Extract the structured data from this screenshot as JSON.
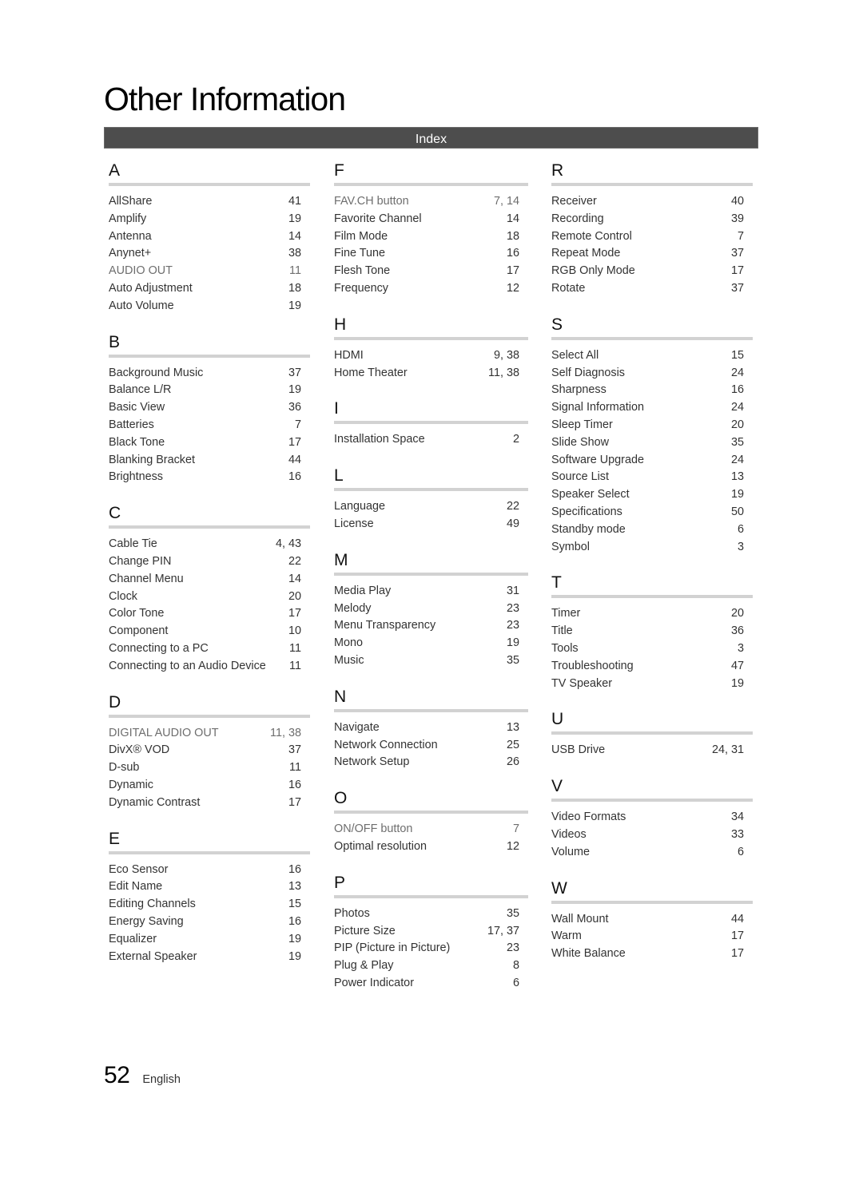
{
  "page": {
    "title": "Other Information",
    "section_bar": "Index",
    "page_number": "52",
    "language": "English"
  },
  "columns": [
    {
      "sections": [
        {
          "letter": "A",
          "entries": [
            {
              "term": "AllShare",
              "pages": "41"
            },
            {
              "term": "Amplify",
              "pages": "19"
            },
            {
              "term": "Antenna",
              "pages": "14"
            },
            {
              "term": "Anynet+",
              "pages": "38"
            },
            {
              "term": "AUDIO OUT",
              "pages": "11",
              "light": true
            },
            {
              "term": "Auto Adjustment",
              "pages": "18"
            },
            {
              "term": "Auto Volume",
              "pages": "19"
            }
          ]
        },
        {
          "letter": "B",
          "entries": [
            {
              "term": "Background Music",
              "pages": "37"
            },
            {
              "term": "Balance L/R",
              "pages": "19"
            },
            {
              "term": "Basic View",
              "pages": "36"
            },
            {
              "term": "Batteries",
              "pages": "7"
            },
            {
              "term": "Black Tone",
              "pages": "17"
            },
            {
              "term": "Blanking Bracket",
              "pages": "44"
            },
            {
              "term": "Brightness",
              "pages": "16"
            }
          ]
        },
        {
          "letter": "C",
          "entries": [
            {
              "term": "Cable Tie",
              "pages": "4, 43"
            },
            {
              "term": "Change PIN",
              "pages": "22"
            },
            {
              "term": "Channel Menu",
              "pages": "14"
            },
            {
              "term": "Clock",
              "pages": "20"
            },
            {
              "term": "Color Tone",
              "pages": "17"
            },
            {
              "term": "Component",
              "pages": "10"
            },
            {
              "term": "Connecting to a PC",
              "pages": "11"
            },
            {
              "term": "Connecting to an Audio Device",
              "pages": "11"
            }
          ]
        },
        {
          "letter": "D",
          "entries": [
            {
              "term": "DIGITAL AUDIO OUT",
              "pages": "11, 38",
              "light": true
            },
            {
              "term": "DivX® VOD",
              "pages": "37"
            },
            {
              "term": "D-sub",
              "pages": "11"
            },
            {
              "term": "Dynamic",
              "pages": "16"
            },
            {
              "term": "Dynamic Contrast",
              "pages": "17"
            }
          ]
        },
        {
          "letter": "E",
          "entries": [
            {
              "term": "Eco Sensor",
              "pages": "16"
            },
            {
              "term": "Edit Name",
              "pages": "13"
            },
            {
              "term": "Editing Channels",
              "pages": "15"
            },
            {
              "term": "Energy Saving",
              "pages": "16"
            },
            {
              "term": "Equalizer",
              "pages": "19"
            },
            {
              "term": "External Speaker",
              "pages": "19"
            }
          ]
        }
      ]
    },
    {
      "sections": [
        {
          "letter": "F",
          "entries": [
            {
              "term": "FAV.CH button",
              "pages": "7, 14",
              "light": true
            },
            {
              "term": "Favorite Channel",
              "pages": "14"
            },
            {
              "term": "Film Mode",
              "pages": "18"
            },
            {
              "term": "Fine Tune",
              "pages": "16"
            },
            {
              "term": "Flesh Tone",
              "pages": "17"
            },
            {
              "term": "Frequency",
              "pages": "12"
            }
          ]
        },
        {
          "letter": "H",
          "entries": [
            {
              "term": "HDMI",
              "pages": "9, 38"
            },
            {
              "term": "Home Theater",
              "pages": "11, 38"
            }
          ]
        },
        {
          "letter": "I",
          "entries": [
            {
              "term": "Installation Space",
              "pages": "2"
            }
          ]
        },
        {
          "letter": "L",
          "entries": [
            {
              "term": "Language",
              "pages": "22"
            },
            {
              "term": "License",
              "pages": "49"
            }
          ]
        },
        {
          "letter": "M",
          "entries": [
            {
              "term": "Media Play",
              "pages": "31"
            },
            {
              "term": "Melody",
              "pages": "23"
            },
            {
              "term": "Menu Transparency",
              "pages": "23"
            },
            {
              "term": "Mono",
              "pages": "19"
            },
            {
              "term": "Music",
              "pages": "35"
            }
          ]
        },
        {
          "letter": "N",
          "entries": [
            {
              "term": "Navigate",
              "pages": "13"
            },
            {
              "term": "Network Connection",
              "pages": "25"
            },
            {
              "term": "Network Setup",
              "pages": "26"
            }
          ]
        },
        {
          "letter": "O",
          "entries": [
            {
              "term": "ON/OFF button",
              "pages": "7",
              "light": true
            },
            {
              "term": "Optimal resolution",
              "pages": "12"
            }
          ]
        },
        {
          "letter": "P",
          "entries": [
            {
              "term": "Photos",
              "pages": "35"
            },
            {
              "term": "Picture Size",
              "pages": "17, 37"
            },
            {
              "term": "PIP (Picture in Picture)",
              "pages": "23"
            },
            {
              "term": "Plug & Play",
              "pages": "8"
            },
            {
              "term": "Power Indicator",
              "pages": "6"
            }
          ]
        }
      ]
    },
    {
      "sections": [
        {
          "letter": "R",
          "entries": [
            {
              "term": "Receiver",
              "pages": "40"
            },
            {
              "term": "Recording",
              "pages": "39"
            },
            {
              "term": "Remote Control",
              "pages": "7"
            },
            {
              "term": "Repeat Mode",
              "pages": "37"
            },
            {
              "term": "RGB Only Mode",
              "pages": "17"
            },
            {
              "term": "Rotate",
              "pages": "37"
            }
          ]
        },
        {
          "letter": "S",
          "entries": [
            {
              "term": "Select All",
              "pages": "15"
            },
            {
              "term": "Self Diagnosis",
              "pages": "24"
            },
            {
              "term": "Sharpness",
              "pages": "16"
            },
            {
              "term": "Signal Information",
              "pages": "24"
            },
            {
              "term": "Sleep Timer",
              "pages": "20"
            },
            {
              "term": "Slide Show",
              "pages": "35"
            },
            {
              "term": "Software Upgrade",
              "pages": "24"
            },
            {
              "term": "Source List",
              "pages": "13"
            },
            {
              "term": "Speaker Select",
              "pages": "19"
            },
            {
              "term": "Specifications",
              "pages": "50"
            },
            {
              "term": "Standby mode",
              "pages": "6"
            },
            {
              "term": "Symbol",
              "pages": "3"
            }
          ]
        },
        {
          "letter": "T",
          "entries": [
            {
              "term": "Timer",
              "pages": "20"
            },
            {
              "term": "Title",
              "pages": "36"
            },
            {
              "term": "Tools",
              "pages": "3"
            },
            {
              "term": "Troubleshooting",
              "pages": "47"
            },
            {
              "term": "TV Speaker",
              "pages": "19"
            }
          ]
        },
        {
          "letter": "U",
          "entries": [
            {
              "term": "USB Drive",
              "pages": "24, 31"
            }
          ]
        },
        {
          "letter": "V",
          "entries": [
            {
              "term": "Video Formats",
              "pages": "34"
            },
            {
              "term": "Videos",
              "pages": "33"
            },
            {
              "term": "Volume",
              "pages": "6"
            }
          ]
        },
        {
          "letter": "W",
          "entries": [
            {
              "term": "Wall Mount",
              "pages": "44"
            },
            {
              "term": "Warm",
              "pages": "17"
            },
            {
              "term": "White Balance",
              "pages": "17"
            }
          ]
        }
      ]
    }
  ]
}
